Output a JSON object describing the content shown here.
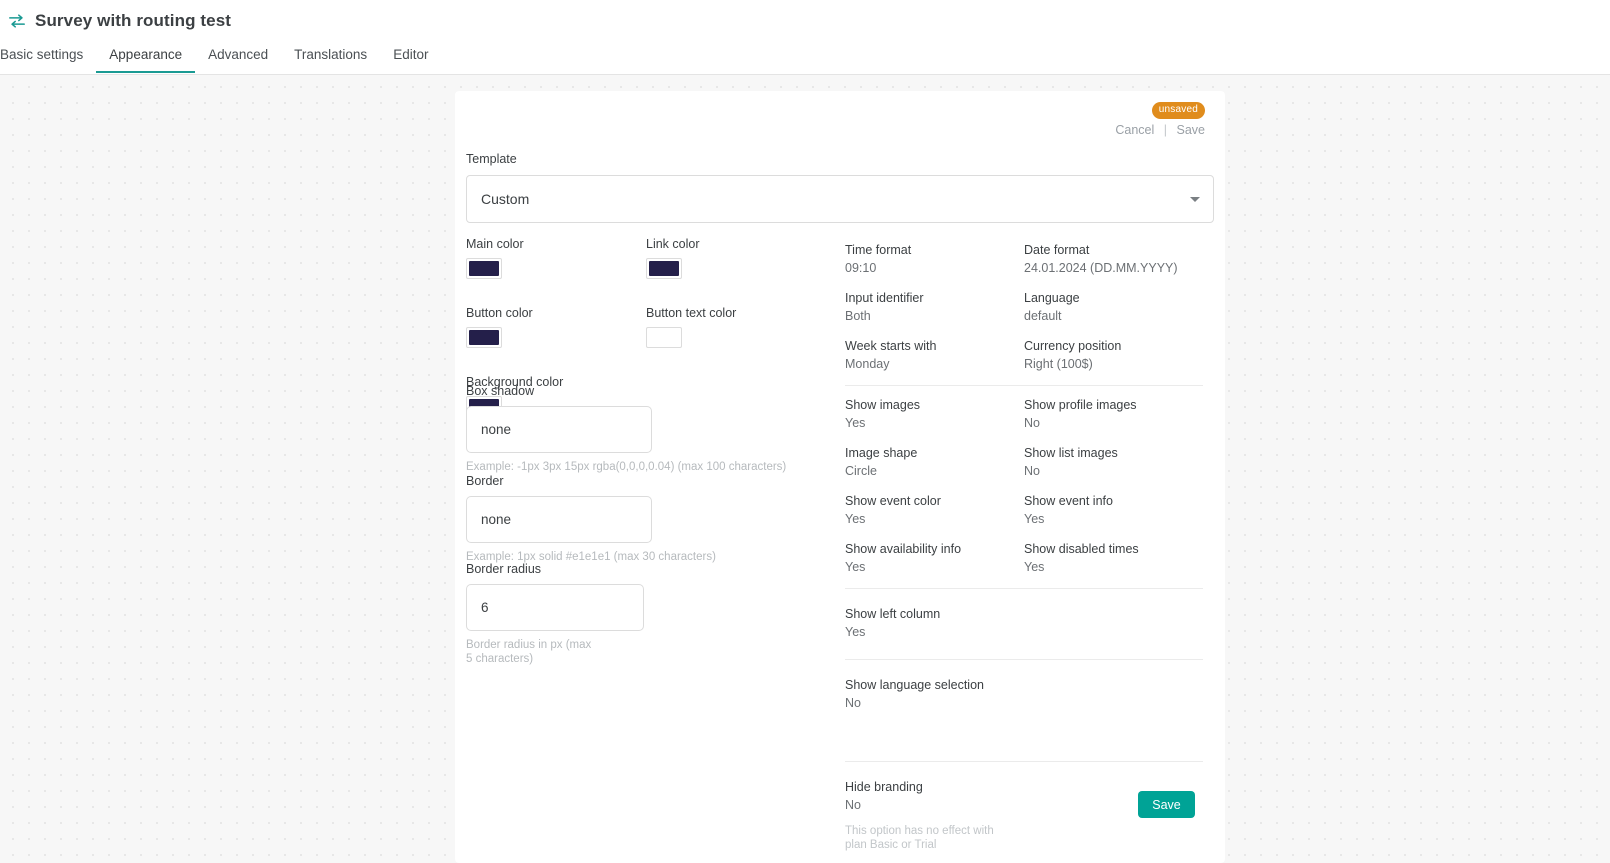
{
  "header": {
    "title": "Survey with routing test",
    "icon": "swap-arrows-icon",
    "accent_color": "#1a9a93",
    "tabs": [
      {
        "label": "Basic settings",
        "active": false
      },
      {
        "label": "Appearance",
        "active": true
      },
      {
        "label": "Advanced",
        "active": false
      },
      {
        "label": "Translations",
        "active": false
      },
      {
        "label": "Editor",
        "active": false
      }
    ]
  },
  "card": {
    "status_badge": "unsaved",
    "badge_color": "#e08c1c",
    "cancel_label": "Cancel",
    "separator": "|",
    "save_link_label": "Save",
    "template": {
      "label": "Template",
      "value": "Custom"
    },
    "colors": [
      {
        "label": "Main color",
        "value": "#241f4a",
        "empty": false
      },
      {
        "label": "Link color",
        "value": "#241f4a",
        "empty": false
      },
      {
        "label": "Button color",
        "value": "#241f4a",
        "empty": false
      },
      {
        "label": "Button text color",
        "value": "#ffffff",
        "empty": true
      },
      {
        "label": "Background color",
        "value": "#241f4a",
        "empty": false
      }
    ],
    "box_shadow": {
      "label": "Box shadow",
      "value": "none",
      "helper": "Example: -1px 3px 15px rgba(0,0,0,0.04) (max 100 characters)"
    },
    "border": {
      "label": "Border",
      "value": "none",
      "helper": "Example: 1px solid #e1e1e1 (max 30 characters)"
    },
    "border_radius": {
      "label": "Border radius",
      "value": "6",
      "helper": "Border radius in px (max 5 characters)"
    },
    "settings_groups": [
      {
        "rows": [
          [
            {
              "label": "Time format",
              "value": "09:10"
            },
            {
              "label": "Date format",
              "value": "24.01.2024 (DD.MM.YYYY)"
            }
          ],
          [
            {
              "label": "Input identifier",
              "value": "Both"
            },
            {
              "label": "Language",
              "value": "default"
            }
          ],
          [
            {
              "label": "Week starts with",
              "value": "Monday"
            },
            {
              "label": "Currency position",
              "value": "Right (100$)"
            }
          ]
        ]
      },
      {
        "rows": [
          [
            {
              "label": "Show images",
              "value": "Yes"
            },
            {
              "label": "Show profile images",
              "value": "No"
            }
          ],
          [
            {
              "label": "Image shape",
              "value": "Circle"
            },
            {
              "label": "Show list images",
              "value": "No"
            }
          ],
          [
            {
              "label": "Show event color",
              "value": "Yes"
            },
            {
              "label": "Show event info",
              "value": "Yes"
            }
          ],
          [
            {
              "label": "Show availability info",
              "value": "Yes"
            },
            {
              "label": "Show disabled times",
              "value": "Yes"
            }
          ]
        ]
      },
      {
        "rows": [
          [
            {
              "label": "Show left column",
              "value": "Yes"
            }
          ]
        ]
      },
      {
        "rows": [
          [
            {
              "label": "Show language selection",
              "value": "No"
            }
          ]
        ]
      },
      {
        "rows": [
          [
            {
              "label": "Hide branding",
              "value": "No"
            }
          ]
        ],
        "note": "This option has no effect with plan Basic or Trial"
      }
    ],
    "save_button": {
      "label": "Save",
      "color": "#00a396"
    }
  }
}
